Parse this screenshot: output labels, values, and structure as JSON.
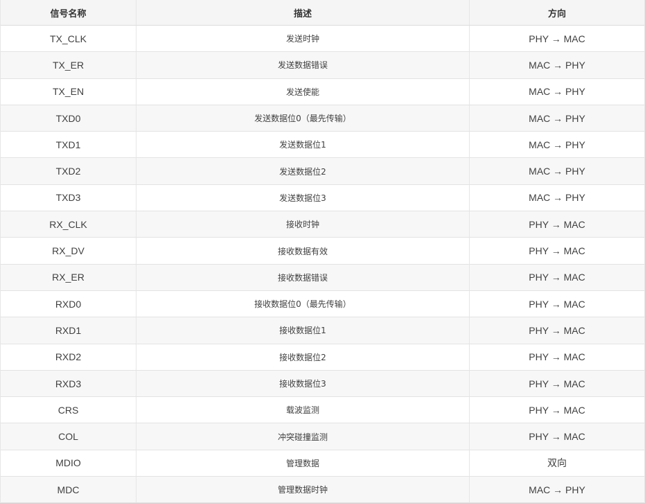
{
  "table": {
    "headers": [
      "信号名称",
      "描述",
      "方向"
    ],
    "rows": [
      [
        "TX_CLK",
        "发送时钟",
        "PHY → MAC"
      ],
      [
        "TX_ER",
        "发送数据错误",
        "MAC → PHY"
      ],
      [
        "TX_EN",
        "发送使能",
        "MAC → PHY"
      ],
      [
        "TXD0",
        "发送数据位0（最先传输）",
        "MAC → PHY"
      ],
      [
        "TXD1",
        "发送数据位1",
        "MAC → PHY"
      ],
      [
        "TXD2",
        "发送数据位2",
        "MAC → PHY"
      ],
      [
        "TXD3",
        "发送数据位3",
        "MAC → PHY"
      ],
      [
        "RX_CLK",
        "接收时钟",
        "PHY → MAC"
      ],
      [
        "RX_DV",
        "接收数据有效",
        "PHY → MAC"
      ],
      [
        "RX_ER",
        "接收数据错误",
        "PHY → MAC"
      ],
      [
        "RXD0",
        "接收数据位0（最先传输）",
        "PHY → MAC"
      ],
      [
        "RXD1",
        "接收数据位1",
        "PHY → MAC"
      ],
      [
        "RXD2",
        "接收数据位2",
        "PHY → MAC"
      ],
      [
        "RXD3",
        "接收数据位3",
        "PHY → MAC"
      ],
      [
        "CRS",
        "载波监测",
        "PHY → MAC"
      ],
      [
        "COL",
        "冲突碰撞监测",
        "PHY → MAC"
      ],
      [
        "MDIO",
        "管理数据",
        "双向"
      ],
      [
        "MDC",
        "管理数据时钟",
        "MAC → PHY"
      ]
    ]
  }
}
